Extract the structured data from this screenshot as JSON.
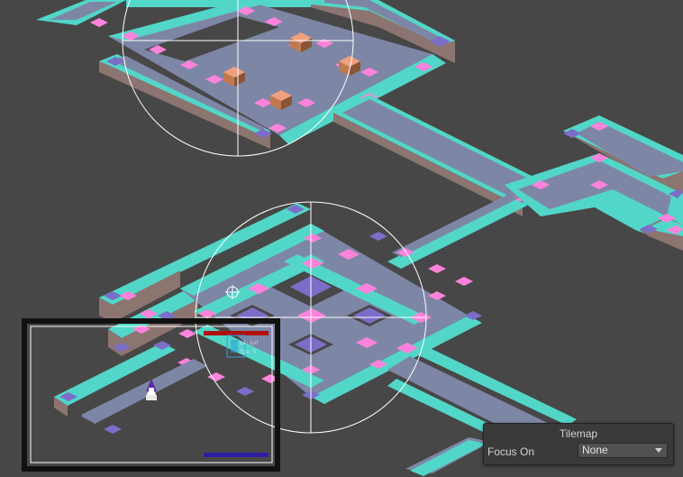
{
  "tilemap_overlay": {
    "title": "Tilemap",
    "focus_label": "Focus On",
    "focus_value": "None"
  },
  "camera_preview": {
    "hud": {
      "line1": "p1: Lvl",
      "line2": "Tps: 5"
    }
  },
  "colors": {
    "background": "#474747",
    "tile_top": "#7e86a6",
    "tile_border": "#52d6c8",
    "tile_side": "#8c7470",
    "corner_marker": "#ff82dc",
    "health_bar": "#b10f0f",
    "mana_bar": "#2e1ea2"
  }
}
